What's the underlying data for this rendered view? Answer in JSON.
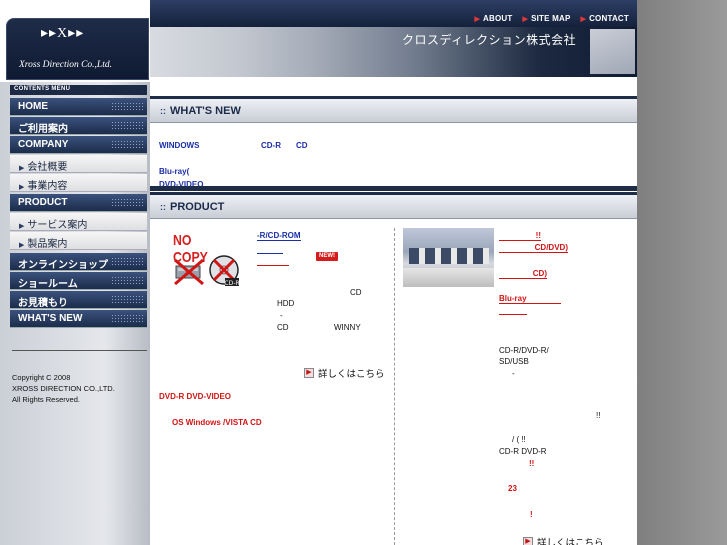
{
  "topnav": {
    "links": [
      {
        "label": "ABOUT"
      },
      {
        "label": "SITE MAP"
      },
      {
        "label": "CONTACT"
      }
    ]
  },
  "banner": {
    "company_name": "クロスディレクション株式会社"
  },
  "logo": {
    "mark": "▸▸X▸▸",
    "brand": "Xross Direction Co.,Ltd."
  },
  "sidebar": {
    "menu_header": "CONTENTS MENU",
    "items": [
      {
        "label": "HOME"
      },
      {
        "label": "ご利用案内"
      },
      {
        "label": "COMPANY"
      },
      {
        "label": "会社概要"
      },
      {
        "label": "事業内容"
      },
      {
        "label": "PRODUCT"
      },
      {
        "label": "サービス案内"
      },
      {
        "label": "製品案内"
      },
      {
        "label": "オンラインショップ"
      },
      {
        "label": "ショールーム"
      },
      {
        "label": "お見積もり"
      },
      {
        "label": "WHAT'S NEW"
      }
    ],
    "copyright": [
      "Copyright C 2008",
      "XROSS DIRECTION CO.,LTD.",
      "All Rights Reserved."
    ]
  },
  "whats_new": {
    "title": "WHAT'S NEW",
    "line1_a": "WINDOWS",
    "line1_b": "CD-R",
    "line1_c": "CD",
    "line2": "Blu-ray(",
    "line3": "DVD-VIDEO"
  },
  "product": {
    "title": "PRODUCT",
    "left": {
      "nocopy_label": "NO COPY",
      "link1": "-R/CD-ROM",
      "new_badge": "NEW!",
      "cd": "CD",
      "hdd": "HDD",
      "dash": "-",
      "cd2": "CD",
      "winny": "WINNY",
      "more": "詳しくはこちら",
      "dvd_line": "DVD-R  DVD-VIDEO",
      "os_line": "OS  Windows  /VISTA      CD"
    },
    "right": {
      "l1": "!!",
      "l2": "CD/DVD)",
      "l3": "CD)",
      "l4": "Blu-ray",
      "l5": "CD-R/DVD-R/",
      "l6": "SD/USB",
      "l7": "-",
      "l8": "!!",
      "l9": "/ (            !!",
      "l10": "CD-R DVD-R",
      "l11": "!!",
      "l12": "23",
      "l13": "!",
      "more": "詳しくはこちら"
    }
  }
}
